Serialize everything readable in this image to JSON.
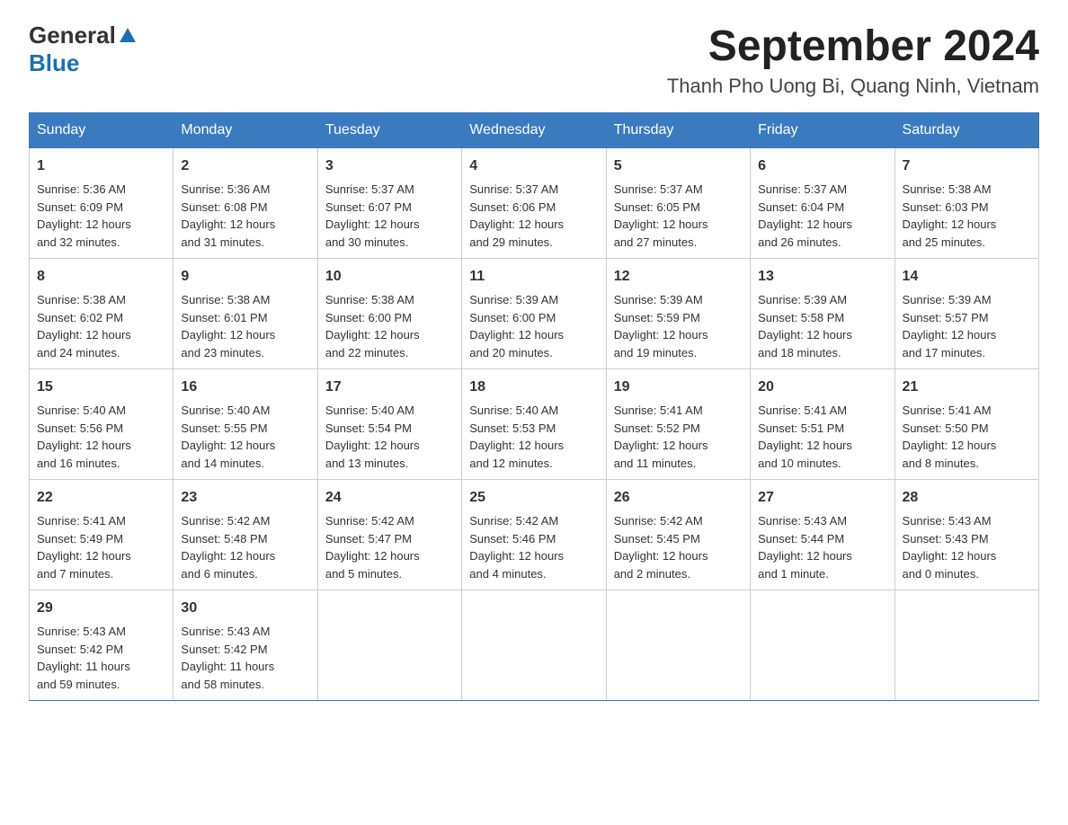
{
  "header": {
    "logo_general": "General",
    "logo_blue": "Blue",
    "month_title": "September 2024",
    "location": "Thanh Pho Uong Bi, Quang Ninh, Vietnam"
  },
  "weekdays": [
    "Sunday",
    "Monday",
    "Tuesday",
    "Wednesday",
    "Thursday",
    "Friday",
    "Saturday"
  ],
  "weeks": [
    [
      {
        "day": "1",
        "sunrise": "5:36 AM",
        "sunset": "6:09 PM",
        "daylight": "12 hours and 32 minutes."
      },
      {
        "day": "2",
        "sunrise": "5:36 AM",
        "sunset": "6:08 PM",
        "daylight": "12 hours and 31 minutes."
      },
      {
        "day": "3",
        "sunrise": "5:37 AM",
        "sunset": "6:07 PM",
        "daylight": "12 hours and 30 minutes."
      },
      {
        "day": "4",
        "sunrise": "5:37 AM",
        "sunset": "6:06 PM",
        "daylight": "12 hours and 29 minutes."
      },
      {
        "day": "5",
        "sunrise": "5:37 AM",
        "sunset": "6:05 PM",
        "daylight": "12 hours and 27 minutes."
      },
      {
        "day": "6",
        "sunrise": "5:37 AM",
        "sunset": "6:04 PM",
        "daylight": "12 hours and 26 minutes."
      },
      {
        "day": "7",
        "sunrise": "5:38 AM",
        "sunset": "6:03 PM",
        "daylight": "12 hours and 25 minutes."
      }
    ],
    [
      {
        "day": "8",
        "sunrise": "5:38 AM",
        "sunset": "6:02 PM",
        "daylight": "12 hours and 24 minutes."
      },
      {
        "day": "9",
        "sunrise": "5:38 AM",
        "sunset": "6:01 PM",
        "daylight": "12 hours and 23 minutes."
      },
      {
        "day": "10",
        "sunrise": "5:38 AM",
        "sunset": "6:00 PM",
        "daylight": "12 hours and 22 minutes."
      },
      {
        "day": "11",
        "sunrise": "5:39 AM",
        "sunset": "6:00 PM",
        "daylight": "12 hours and 20 minutes."
      },
      {
        "day": "12",
        "sunrise": "5:39 AM",
        "sunset": "5:59 PM",
        "daylight": "12 hours and 19 minutes."
      },
      {
        "day": "13",
        "sunrise": "5:39 AM",
        "sunset": "5:58 PM",
        "daylight": "12 hours and 18 minutes."
      },
      {
        "day": "14",
        "sunrise": "5:39 AM",
        "sunset": "5:57 PM",
        "daylight": "12 hours and 17 minutes."
      }
    ],
    [
      {
        "day": "15",
        "sunrise": "5:40 AM",
        "sunset": "5:56 PM",
        "daylight": "12 hours and 16 minutes."
      },
      {
        "day": "16",
        "sunrise": "5:40 AM",
        "sunset": "5:55 PM",
        "daylight": "12 hours and 14 minutes."
      },
      {
        "day": "17",
        "sunrise": "5:40 AM",
        "sunset": "5:54 PM",
        "daylight": "12 hours and 13 minutes."
      },
      {
        "day": "18",
        "sunrise": "5:40 AM",
        "sunset": "5:53 PM",
        "daylight": "12 hours and 12 minutes."
      },
      {
        "day": "19",
        "sunrise": "5:41 AM",
        "sunset": "5:52 PM",
        "daylight": "12 hours and 11 minutes."
      },
      {
        "day": "20",
        "sunrise": "5:41 AM",
        "sunset": "5:51 PM",
        "daylight": "12 hours and 10 minutes."
      },
      {
        "day": "21",
        "sunrise": "5:41 AM",
        "sunset": "5:50 PM",
        "daylight": "12 hours and 8 minutes."
      }
    ],
    [
      {
        "day": "22",
        "sunrise": "5:41 AM",
        "sunset": "5:49 PM",
        "daylight": "12 hours and 7 minutes."
      },
      {
        "day": "23",
        "sunrise": "5:42 AM",
        "sunset": "5:48 PM",
        "daylight": "12 hours and 6 minutes."
      },
      {
        "day": "24",
        "sunrise": "5:42 AM",
        "sunset": "5:47 PM",
        "daylight": "12 hours and 5 minutes."
      },
      {
        "day": "25",
        "sunrise": "5:42 AM",
        "sunset": "5:46 PM",
        "daylight": "12 hours and 4 minutes."
      },
      {
        "day": "26",
        "sunrise": "5:42 AM",
        "sunset": "5:45 PM",
        "daylight": "12 hours and 2 minutes."
      },
      {
        "day": "27",
        "sunrise": "5:43 AM",
        "sunset": "5:44 PM",
        "daylight": "12 hours and 1 minute."
      },
      {
        "day": "28",
        "sunrise": "5:43 AM",
        "sunset": "5:43 PM",
        "daylight": "12 hours and 0 minutes."
      }
    ],
    [
      {
        "day": "29",
        "sunrise": "5:43 AM",
        "sunset": "5:42 PM",
        "daylight": "11 hours and 59 minutes."
      },
      {
        "day": "30",
        "sunrise": "5:43 AM",
        "sunset": "5:42 PM",
        "daylight": "11 hours and 58 minutes."
      },
      null,
      null,
      null,
      null,
      null
    ]
  ]
}
